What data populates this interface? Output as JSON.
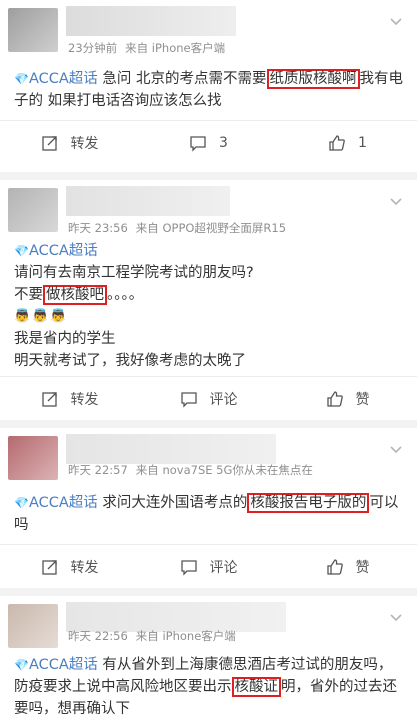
{
  "posts": [
    {
      "time": "23分钟前",
      "source": "来自 iPhone客户端",
      "topic": "ACCA超话",
      "text_before": "急问 北京的考点需不需要",
      "text_hl": "纸质版核酸啊",
      "text_after": "我有电子的 如果打电话咨询应该怎么找",
      "actions": {
        "repost": "转发",
        "comment": "3",
        "like": "1"
      }
    },
    {
      "time": "昨天 23:56",
      "source": "来自 OPPO超视野全面屏R15",
      "topic": "ACCA超话",
      "line1": "请问有去南京工程学院考试的朋友吗?",
      "line2_before": "不要",
      "line2_hl": "做核酸吧",
      "line2_after": "。。。。",
      "emoji": "👼👼👼",
      "line3": "我是省内的学生",
      "line4": "明天就考试了，我好像考虑的太晚了",
      "actions": {
        "repost": "转发",
        "comment": "评论",
        "like": "赞"
      }
    },
    {
      "time": "昨天 22:57",
      "source": "来自 nova7SE 5G你从未在焦点在",
      "topic": "ACCA超话",
      "text_before": "求问大连外国语考点的",
      "text_hl": "核酸报告电子版的",
      "text_after": "可以吗",
      "actions": {
        "repost": "转发",
        "comment": "评论",
        "like": "赞"
      }
    },
    {
      "time": "昨天 22:56",
      "source": "来自 iPhone客户端",
      "topic": "ACCA超话",
      "text_before": "有从省外到上海康德思酒店考过试的朋友吗，防疫要求上说中高风险地区要出示",
      "text_hl": "核酸证",
      "text_after": "明，省外的过去还要吗，想再确认下"
    }
  ]
}
